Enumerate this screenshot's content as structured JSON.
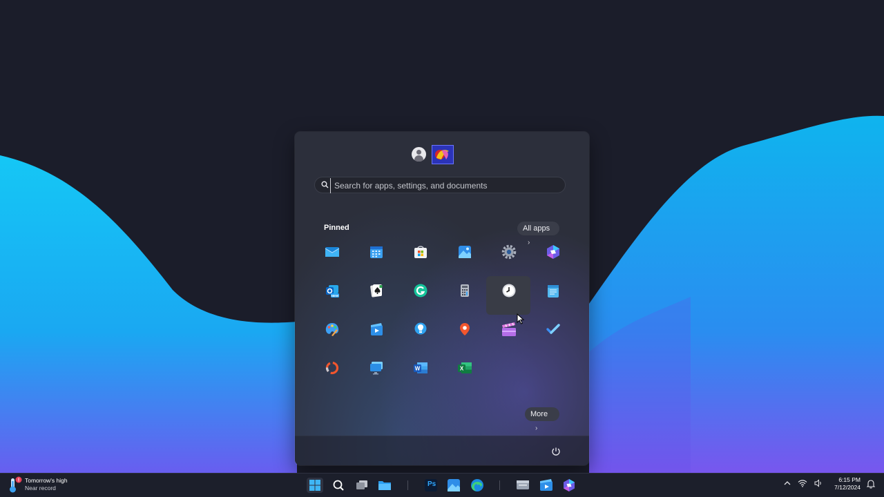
{
  "search": {
    "placeholder": "Search for apps, settings, and documents"
  },
  "pinned": {
    "title": "Pinned",
    "all_apps_label": "All apps",
    "more_label": "More",
    "apps": [
      {
        "icon": "mail-icon"
      },
      {
        "icon": "calendar-icon"
      },
      {
        "icon": "microsoft-store-icon"
      },
      {
        "icon": "photos-icon"
      },
      {
        "icon": "settings-gear-icon"
      },
      {
        "icon": "copilot-icon"
      },
      {
        "icon": "outlook-new-icon"
      },
      {
        "icon": "solitaire-icon"
      },
      {
        "icon": "grammarly-icon"
      },
      {
        "icon": "calculator-icon"
      },
      {
        "icon": "clock-icon"
      },
      {
        "icon": "notepad-icon"
      },
      {
        "icon": "paint-icon"
      },
      {
        "icon": "clipchamp-icon"
      },
      {
        "icon": "tips-icon"
      },
      {
        "icon": "maps-icon"
      },
      {
        "icon": "clapboard-icon"
      },
      {
        "icon": "todo-icon"
      },
      {
        "icon": "media-ring-icon"
      },
      {
        "icon": "remote-desktop-icon"
      },
      {
        "icon": "word-icon"
      },
      {
        "icon": "excel-icon"
      }
    ]
  },
  "weather": {
    "line1": "Tomorrow's high",
    "line2": "Near record"
  },
  "taskbar": {
    "apps": [
      "start-icon",
      "search-icon",
      "task-view-icon",
      "file-explorer-icon",
      "photoshop-icon",
      "photos-icon",
      "edge-icon",
      "file-manager-icon",
      "clipchamp-icon",
      "copilot-icon"
    ],
    "photoshop_label": "Ps"
  },
  "tray": {
    "time": "6:15 PM",
    "date": "7/12/2024"
  },
  "colors": {
    "accent": "#0ea5e9",
    "menu_bg": "#2c2f3b",
    "desktop_bg": "#1b1d2a"
  }
}
